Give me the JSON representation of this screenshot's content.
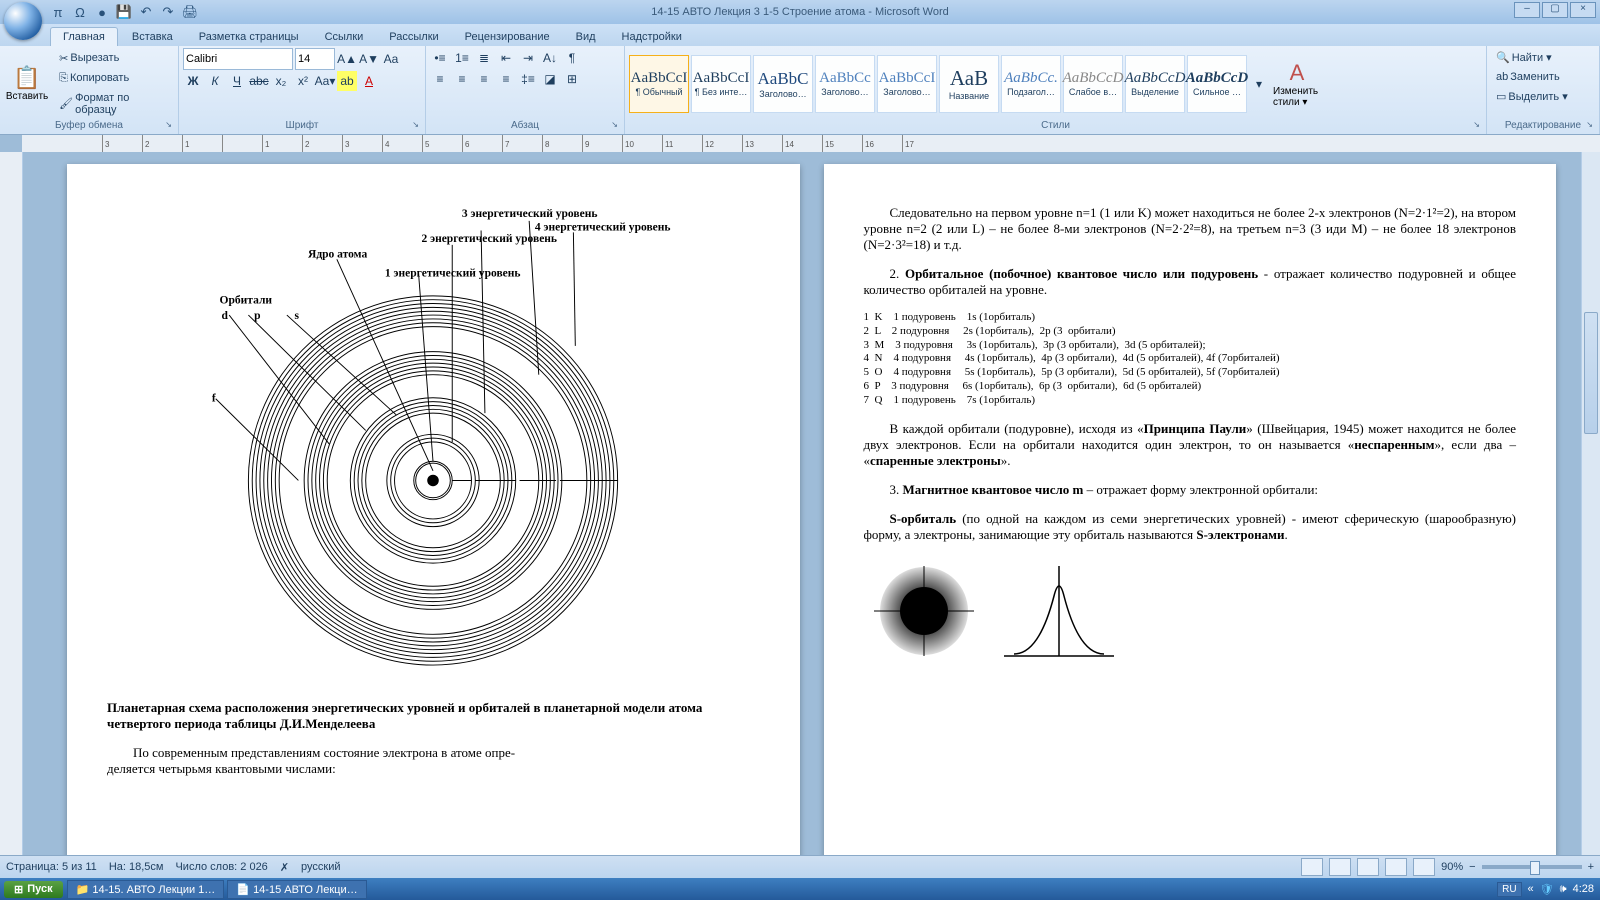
{
  "window": {
    "title": "14-15  АВТО Лекция 3  1-5  Строение  атома - Microsoft Word"
  },
  "qat_icons": [
    "π",
    "Ω",
    "●",
    "💾",
    "↶",
    "↷",
    "🖨"
  ],
  "tabs": [
    "Главная",
    "Вставка",
    "Разметка страницы",
    "Ссылки",
    "Рассылки",
    "Рецензирование",
    "Вид",
    "Надстройки"
  ],
  "ribbon": {
    "clipboard": {
      "label": "Буфер обмена",
      "paste": "Вставить",
      "cut": "Вырезать",
      "copy": "Копировать",
      "format": "Формат по образцу"
    },
    "font": {
      "label": "Шрифт",
      "name": "Calibri",
      "size": "14"
    },
    "paragraph": {
      "label": "Абзац"
    },
    "styles": {
      "label": "Стили",
      "items": [
        {
          "samp": "AaBbCcI",
          "name": "¶ Обычный"
        },
        {
          "samp": "AaBbCcI",
          "name": "¶ Без инте…"
        },
        {
          "samp": "AaBbC",
          "name": "Заголово…"
        },
        {
          "samp": "AaBbCc",
          "name": "Заголово…"
        },
        {
          "samp": "AaBbCcI",
          "name": "Заголово…"
        },
        {
          "samp": "АаВ",
          "name": "Название"
        },
        {
          "samp": "AaBbCc.",
          "name": "Подзагол…"
        },
        {
          "samp": "AaBbCcD",
          "name": "Слабое в…"
        },
        {
          "samp": "AaBbCcD",
          "name": "Выделение"
        },
        {
          "samp": "AaBbCcD",
          "name": "Сильное …"
        }
      ],
      "change": "Изменить стили ▾"
    },
    "editing": {
      "label": "Редактирование",
      "find": "Найти ▾",
      "replace": "Заменить",
      "select": "Выделить ▾"
    }
  },
  "ruler_numbers": [
    "3",
    "2",
    "1",
    "",
    "1",
    "2",
    "3",
    "4",
    "5",
    "6",
    "7",
    "8",
    "9",
    "10",
    "11",
    "12",
    "13",
    "14",
    "15",
    "16",
    "17"
  ],
  "page_left": {
    "labels": {
      "nucleus": "Ядро атома",
      "lvl1": "1 энергетический уровень",
      "lvl2": "2 энергетический уровень",
      "lvl3": "3 энергетический уровень",
      "lvl4": "4 энергетический уровень",
      "orbitals": "Орбитали",
      "d": "d",
      "p": "p",
      "s": "s",
      "f": "f"
    },
    "caption": "Планетарная схема расположения энергетических уровней и орбиталей в планетарной  модели атома четвертого периода  таблицы  Д.И.Менделеева",
    "body1": "По современным представлениям состояние электрона в атоме опре-",
    "body2": "деляется четырьмя квантовыми числами:"
  },
  "page_right": {
    "para1": "Следовательно на первом уровне n=1 (1 или K)  может находиться не более 2-х электронов (N=2·1²=2), на втором уровне n=2 (2 или  L) – не более 8-ми электронов (N=2·2²=8), на третьем n=3 (3 иди  M) – не более 18 электронов (N=2·3²=18) и т.д.",
    "heading2_pre": "2. ",
    "heading2_b": "Орбитальное (побочное) квантовое число  или подуровень",
    "heading2_post": "  -  отра­жает количество подуровней и общее количество орбиталей на уровне.",
    "table": [
      "1  K    1 подуровень    1s (1орбиталь)",
      "2  L    2 подуровня     2s (1орбиталь),  2p (3  орбитали)",
      "3  M    3 подуровня     3s (1орбиталь),  3p (3 орбитали),  3d (5 орбиталей);",
      "4  N    4 подуровня     4s (1орбиталь),  4p (3 орбитали),  4d (5 орбиталей), 4f (7орбиталей)",
      "5  O    4 подуровня     5s (1орбиталь),  5p (3 орбитали),  5d (5 орбиталей), 5f (7орбиталей)",
      "6  P    3 подуровня     6s (1орбиталь),  6p (3  орбитали),  6d (5 орбиталей)",
      "7  Q    1 подуровень    7s (1орбиталь)"
    ],
    "para3_a": "В каждой орбитали (подуровне), исходя из  «",
    "para3_b": "Принципа Паули",
    "para3_c": "» (Швей­цария, 1945)  может находится не более двух электронов.  Если на орбитали находится один электрон, то он называется «",
    "para3_d": "неспаренным",
    "para3_e": "», если два – «",
    "para3_f": "спаренные электроны",
    "para3_g": "».",
    "heading3_pre": "3. ",
    "heading3_b": "Магнитное квантовое число m",
    "heading3_post": " – отражает форму электронной орбитали:",
    "para4_a": "S-орбиталь",
    "para4_b": "  (по одной на каждом из семи энергетических уровней) -  имеют сферическую (шарообразную) форму, а электроны, занимающие эту орбиталь называются ",
    "para4_c": "S-электронами",
    "para4_d": "."
  },
  "status": {
    "page": "Страница: 5 из 11",
    "pos": "На: 18,5см",
    "words": "Число слов: 2 026",
    "lang": "русский",
    "zoom": "90%"
  },
  "taskbar": {
    "start": "Пуск",
    "task1": "14-15. АВТО  Лекции 1…",
    "task2": "14-15   АВТО Лекци…",
    "lang": "RU",
    "clock": "4:28"
  }
}
